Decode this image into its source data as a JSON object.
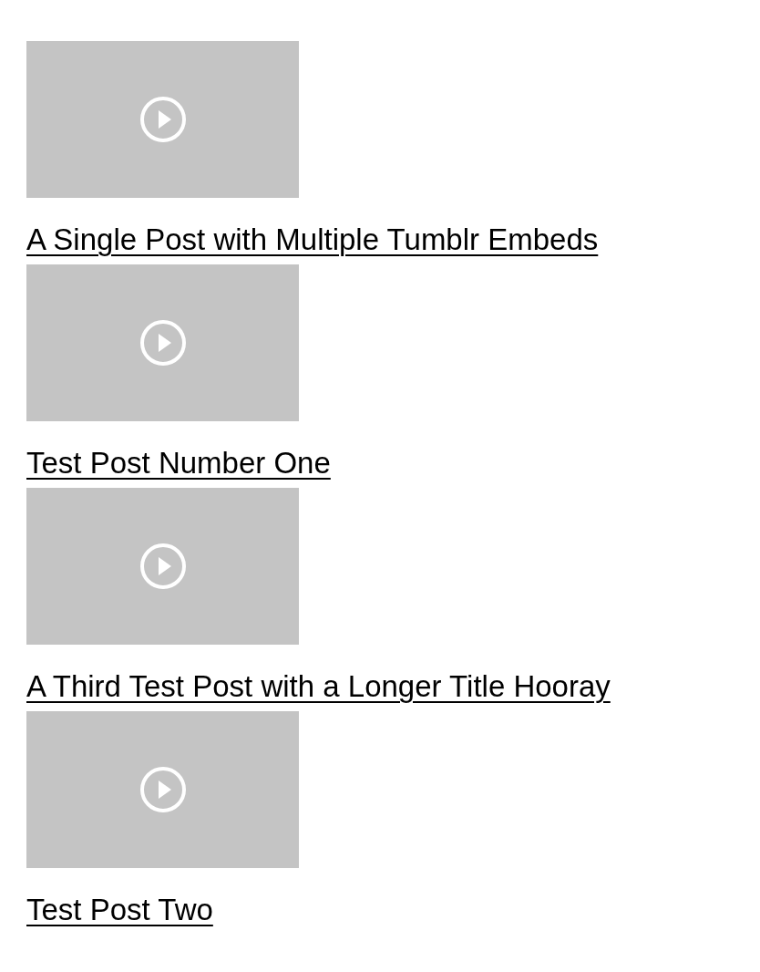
{
  "posts": [
    {
      "kind": "video",
      "title": "A Single Post with Multiple Tumblr Embeds"
    },
    {
      "kind": "video",
      "title": "Test Post Number One"
    },
    {
      "kind": "video",
      "title": "A Third Test Post with a Longer Title Hooray"
    },
    {
      "kind": "video",
      "title": "Test Post Two"
    }
  ]
}
